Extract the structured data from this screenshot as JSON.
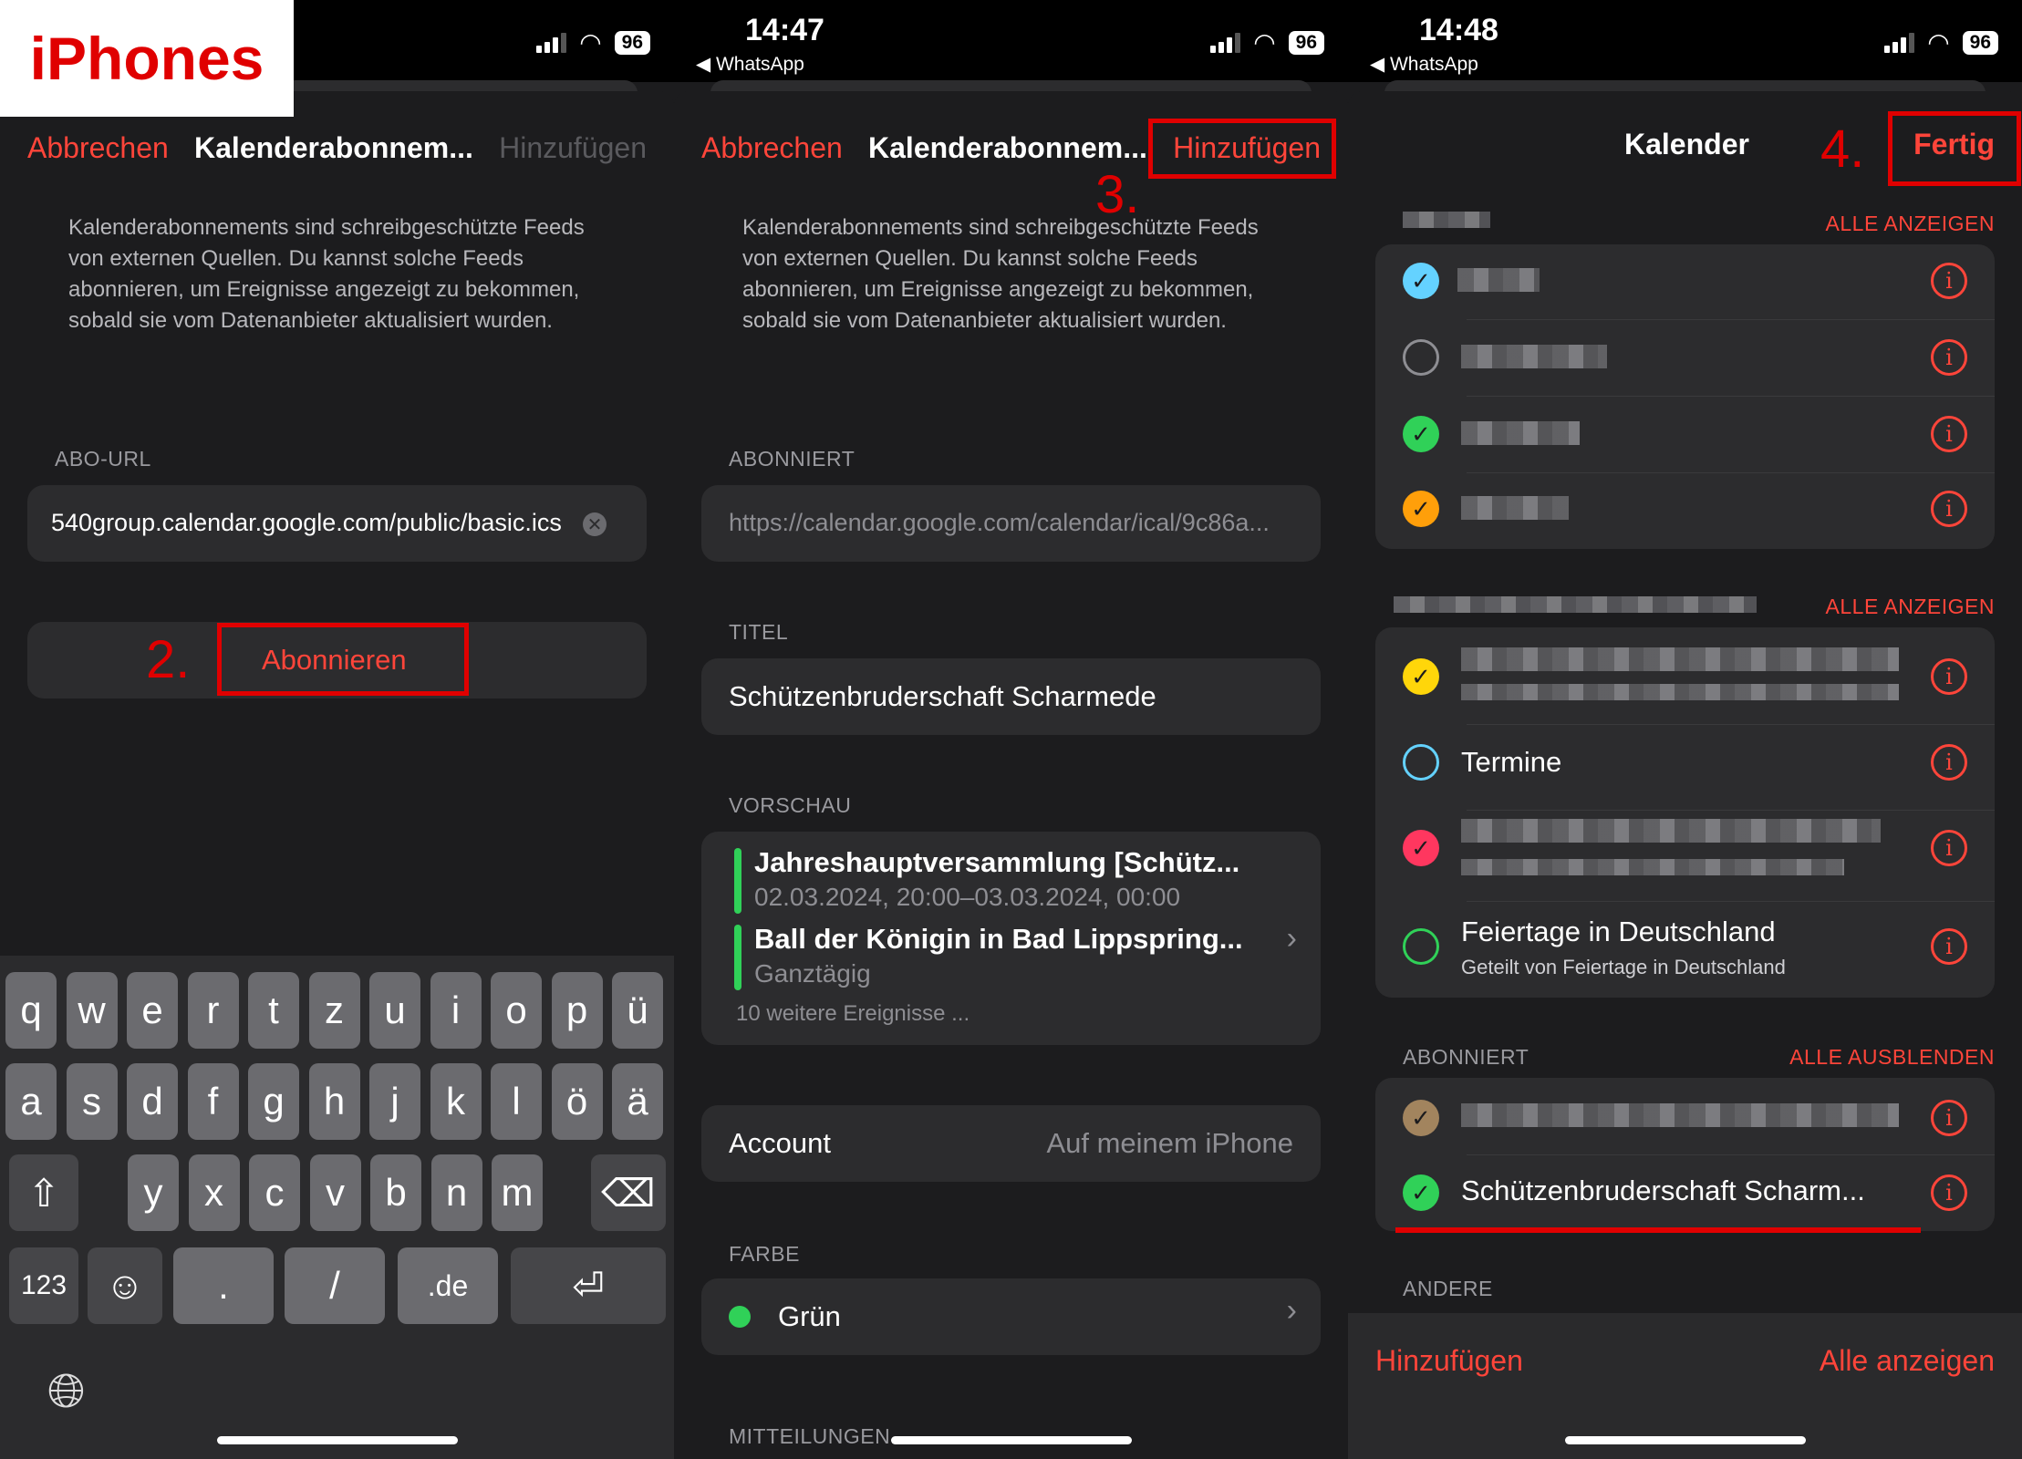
{
  "watermark": "iPhones",
  "battery": "96",
  "phone1": {
    "nav": {
      "cancel": "Abbrechen",
      "title": "Kalenderabonnem...",
      "add": "Hinzufügen"
    },
    "description": "Kalenderabonnements sind schreibgeschützte Feeds von externen Quellen. Du kannst solche Feeds abonnieren, um Ereignisse angezeigt zu bekommen, sobald sie vom Datenanbieter aktualisiert wurden.",
    "url_label": "ABO-URL",
    "url_value": "540group.calendar.google.com/public/basic.ics",
    "subscribe_label": "Abonnieren",
    "step": "2.",
    "keyboard": {
      "row1": [
        "q",
        "w",
        "e",
        "r",
        "t",
        "z",
        "u",
        "i",
        "o",
        "p",
        "ü"
      ],
      "row2": [
        "a",
        "s",
        "d",
        "f",
        "g",
        "h",
        "j",
        "k",
        "l",
        "ö",
        "ä"
      ],
      "row3": [
        "y",
        "x",
        "c",
        "v",
        "b",
        "n",
        "m"
      ],
      "numbers": "123",
      "dot": ".",
      "slash": "/",
      "domain": ".de"
    }
  },
  "phone2": {
    "time": "14:47",
    "back_app": "WhatsApp",
    "nav": {
      "cancel": "Abbrechen",
      "title": "Kalenderabonnem...",
      "add": "Hinzufügen"
    },
    "step": "3.",
    "description": "Kalenderabonnements sind schreibgeschützte Feeds von externen Quellen. Du kannst solche Feeds abonnieren, um Ereignisse angezeigt zu bekommen, sobald sie vom Datenanbieter aktualisiert wurden.",
    "subscribed_label": "ABONNIERT",
    "subscribed_url": "https://calendar.google.com/calendar/ical/9c86a...",
    "title_label": "TITEL",
    "title_value": "Schützenbruderschaft Scharmede",
    "preview_label": "VORSCHAU",
    "events": [
      {
        "title": "Jahreshauptversammlung [Schütz...",
        "time": "02.03.2024, 20:00–03.03.2024, 00:00"
      },
      {
        "title": "Ball der Königin in Bad Lippspring...",
        "time": "Ganztägig"
      }
    ],
    "more_events": "10 weitere Ereignisse ...",
    "account_label": "Account",
    "account_value": "Auf meinem iPhone",
    "color_label": "FARBE",
    "color_value": "Grün",
    "color_hex": "#30d158",
    "notifications_label": "MITTEILUNGEN"
  },
  "phone3": {
    "time": "14:48",
    "back_app": "WhatsApp",
    "nav": {
      "title": "Kalender",
      "done": "Fertig"
    },
    "step": "4.",
    "show_all": "ALLE ANZEIGEN",
    "group1_colors": [
      "#64d2ff",
      "",
      "#30d158",
      "#ff9f0a"
    ],
    "group2": {
      "termine": "Termine",
      "feiertage": "Feiertage in Deutschland",
      "feiertage_sub": "Geteilt von Feiertage in Deutschland"
    },
    "subscribed_label": "ABONNIERT",
    "hide_all": "ALLE AUSBLENDEN",
    "subscribed_item": "Schützenbruderschaft Scharm...",
    "other_label": "ANDERE",
    "bottom": {
      "add": "Hinzufügen",
      "show_all": "Alle anzeigen"
    }
  }
}
